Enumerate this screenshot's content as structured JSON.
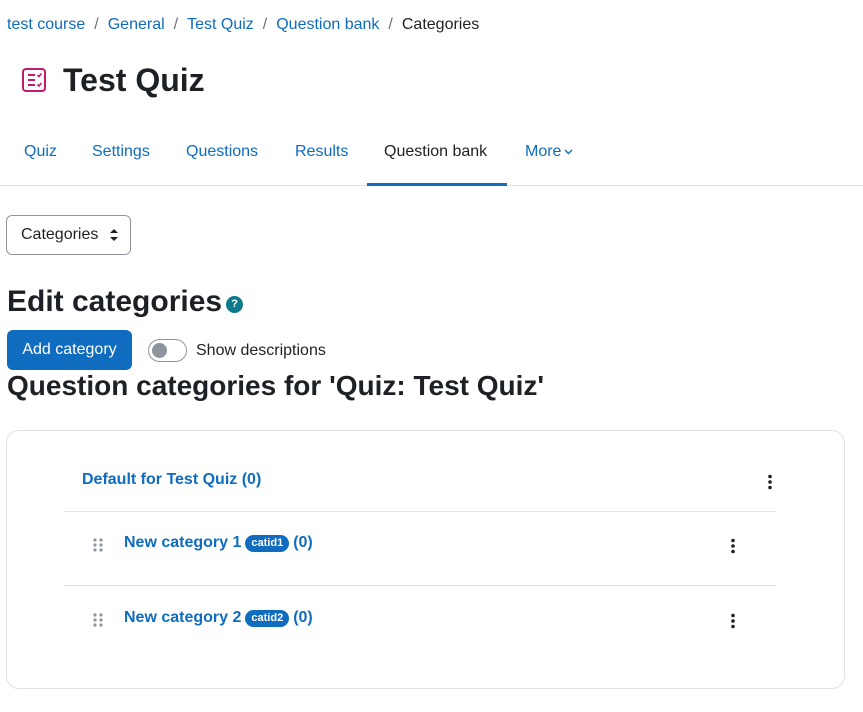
{
  "breadcrumb": {
    "items": [
      "test course",
      "General",
      "Test Quiz",
      "Question bank"
    ],
    "current": "Categories",
    "separator": "/"
  },
  "header": {
    "title": "Test Quiz",
    "icon": "quiz-icon"
  },
  "tabs": [
    {
      "label": "Quiz"
    },
    {
      "label": "Settings"
    },
    {
      "label": "Questions"
    },
    {
      "label": "Results"
    },
    {
      "label": "Question bank",
      "active": true
    },
    {
      "label": "More"
    }
  ],
  "select": {
    "value": "Categories"
  },
  "edit": {
    "title": "Edit categories",
    "help": "?"
  },
  "actions": {
    "add_category": "Add category",
    "show_descriptions": "Show descriptions"
  },
  "section_title": "Question categories for 'Quiz: Test Quiz'",
  "categories": [
    {
      "name": "Default for Test Quiz",
      "count": "(0)"
    },
    {
      "name": "New category 1",
      "idnumber": "catid1",
      "count": "(0)"
    },
    {
      "name": "New category 2",
      "idnumber": "catid2",
      "count": "(0)"
    }
  ],
  "colors": {
    "accent": "#0f6cbf",
    "quiz_icon": "#c01c6e",
    "help": "#0f7a8c"
  }
}
